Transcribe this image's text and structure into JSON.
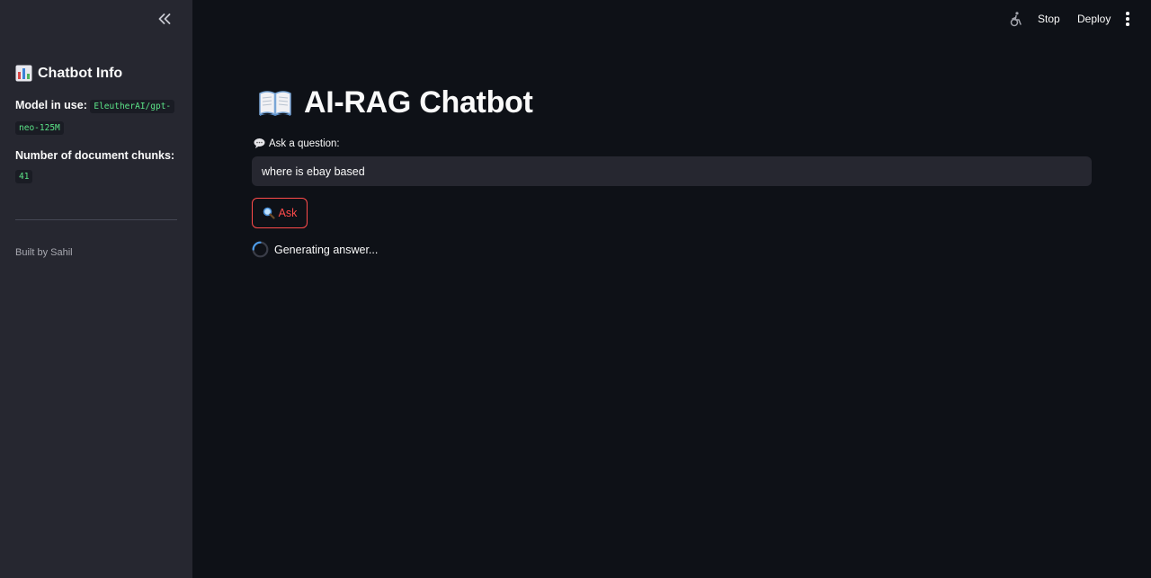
{
  "sidebar": {
    "title": "Chatbot Info",
    "model_label": "Model in use:",
    "model_value": "EleutherAI/gpt-neo-125M",
    "model_value_line1": "EleutherAI/gpt-",
    "model_value_line2": "neo-125M",
    "chunks_label": "Number of document chunks:",
    "chunks_value": "41",
    "footer": "Built by Sahil"
  },
  "topbar": {
    "stop_label": "Stop",
    "deploy_label": "Deploy"
  },
  "main": {
    "title": "AI-RAG Chatbot",
    "question_label": "Ask a question:",
    "question_value": "where is ebay based",
    "ask_label": "Ask",
    "status_text": "Generating answer..."
  },
  "colors": {
    "background": "#0e1117",
    "sidebar": "#262730",
    "accent": "#ff4b4b",
    "code_text": "#5ce488"
  }
}
